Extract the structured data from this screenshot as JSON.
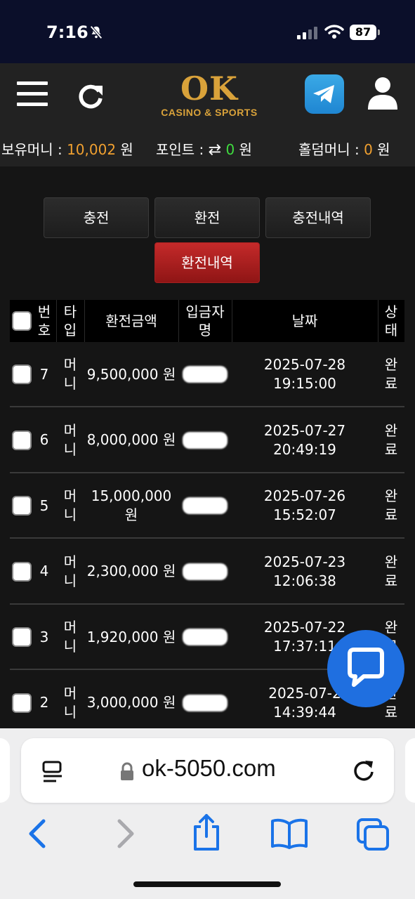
{
  "status_bar": {
    "time": "7:16",
    "battery": "87"
  },
  "header": {
    "logo_main": "OK",
    "logo_sub": "CASINO & SPORTS"
  },
  "balance": {
    "money_label": "보유머니 :",
    "money_value": "10,002",
    "money_unit": "원",
    "point_label": "포인트 :",
    "point_value": "0",
    "point_unit": "원",
    "holdem_label": "홀덤머니 :",
    "holdem_value": "0",
    "holdem_unit": "원"
  },
  "tabs": {
    "deposit": "충전",
    "withdraw": "환전",
    "deposit_history": "충전내역",
    "withdraw_history": "환전내역"
  },
  "table": {
    "headers": {
      "number": "번\n호",
      "type": "타\n입",
      "amount": "환전금액",
      "depositor": "입금자\n명",
      "date": "날짜",
      "status": "상\n태"
    },
    "rows": [
      {
        "no": "7",
        "type": "머\n니",
        "amount": "9,500,000 원",
        "date": "2025-07-28\n19:15:00",
        "status": "완\n료"
      },
      {
        "no": "6",
        "type": "머\n니",
        "amount": "8,000,000 원",
        "date": "2025-07-27\n20:49:19",
        "status": "완\n료"
      },
      {
        "no": "5",
        "type": "머\n니",
        "amount": "15,000,000\n원",
        "date": "2025-07-26\n15:52:07",
        "status": "완\n료"
      },
      {
        "no": "4",
        "type": "머\n니",
        "amount": "2,300,000 원",
        "date": "2025-07-23\n12:06:38",
        "status": "완\n료"
      },
      {
        "no": "3",
        "type": "머\n니",
        "amount": "1,920,000 원",
        "date": "2025-07-22\n17:37:11",
        "status": "완\n료"
      },
      {
        "no": "2",
        "type": "머\n니",
        "amount": "3,000,000 원",
        "date": "2025-07-2\n14:39:44",
        "status": "완\n료"
      }
    ]
  },
  "browser": {
    "url": "ok-5050.com"
  },
  "colors": {
    "accent_orange": "#f0a030",
    "accent_green": "#3fdc3f",
    "active_tab": "#b82222",
    "chat_fab": "#1f6fe0",
    "browser_blue": "#1a73e8"
  }
}
